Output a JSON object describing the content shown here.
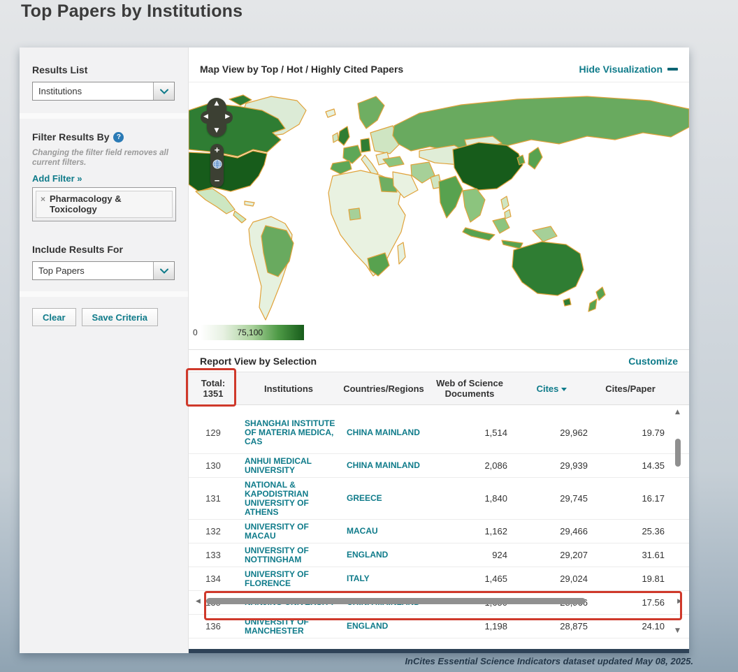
{
  "page": {
    "title": "Top Papers by Institutions",
    "footer": "InCites Essential Science Indicators dataset updated May 08, 2025."
  },
  "sidebar": {
    "results_list": {
      "label": "Results List",
      "value": "Institutions"
    },
    "filter": {
      "label": "Filter Results By",
      "help": "?",
      "note": "Changing the filter field removes all current filters.",
      "add_filter": "Add Filter »",
      "chip_remove": "×",
      "chip_label": "Pharmacology & Toxicology"
    },
    "include": {
      "label": "Include Results For",
      "value": "Top Papers"
    },
    "clear_label": "Clear",
    "save_label": "Save Criteria"
  },
  "map": {
    "header": "Map View by Top / Hot / Highly Cited Papers",
    "hide_label": "Hide Visualization",
    "legend": {
      "min": "0",
      "max": "75,100"
    },
    "controls": {
      "pan_up": "▲",
      "pan_down": "▼",
      "pan_left": "◀",
      "pan_right": "▶",
      "zoom_in": "+",
      "zoom_out": "−"
    }
  },
  "report": {
    "header": "Report View by Selection",
    "customize": "Customize",
    "total_label": "Total:",
    "total_value": "1351",
    "columns": {
      "institutions": "Institutions",
      "countries": "Countries/Regions",
      "docs": "Web of Science Documents",
      "cites": "Cites",
      "cites_per_paper": "Cites/Paper"
    },
    "rows": [
      {
        "rank": "129",
        "institution": "SHANGHAI INSTITUTE OF MATERIA MEDICA, CAS",
        "country": "CHINA MAINLAND",
        "docs": "1,514",
        "cites": "29,962",
        "cites_per_paper": "19.79"
      },
      {
        "rank": "130",
        "institution": "ANHUI MEDICAL UNIVERSITY",
        "country": "CHINA MAINLAND",
        "docs": "2,086",
        "cites": "29,939",
        "cites_per_paper": "14.35"
      },
      {
        "rank": "131",
        "institution": "NATIONAL & KAPODISTRIAN UNIVERSITY OF ATHENS",
        "country": "GREECE",
        "docs": "1,840",
        "cites": "29,745",
        "cites_per_paper": "16.17"
      },
      {
        "rank": "132",
        "institution": "UNIVERSITY OF MACAU",
        "country": "MACAU",
        "docs": "1,162",
        "cites": "29,466",
        "cites_per_paper": "25.36"
      },
      {
        "rank": "133",
        "institution": "UNIVERSITY OF NOTTINGHAM",
        "country": "ENGLAND",
        "docs": "924",
        "cites": "29,207",
        "cites_per_paper": "31.61"
      },
      {
        "rank": "134",
        "institution": "UNIVERSITY OF FLORENCE",
        "country": "ITALY",
        "docs": "1,465",
        "cites": "29,024",
        "cites_per_paper": "19.81"
      },
      {
        "rank": "135",
        "institution": "NANJING UNIVERSITY",
        "country": "CHINA MAINLAND",
        "docs": "1,650",
        "cites": "28,966",
        "cites_per_paper": "17.56"
      },
      {
        "rank": "136",
        "institution": "UNIVERSITY OF MANCHESTER",
        "country": "ENGLAND",
        "docs": "1,198",
        "cites": "28,875",
        "cites_per_paper": "24.10"
      }
    ]
  },
  "colors": {
    "accent_teal": "#0f7b8a",
    "annotation_red": "#cf392b",
    "map_border_orange": "#e0a23a",
    "map_max_green": "#175c1b"
  }
}
